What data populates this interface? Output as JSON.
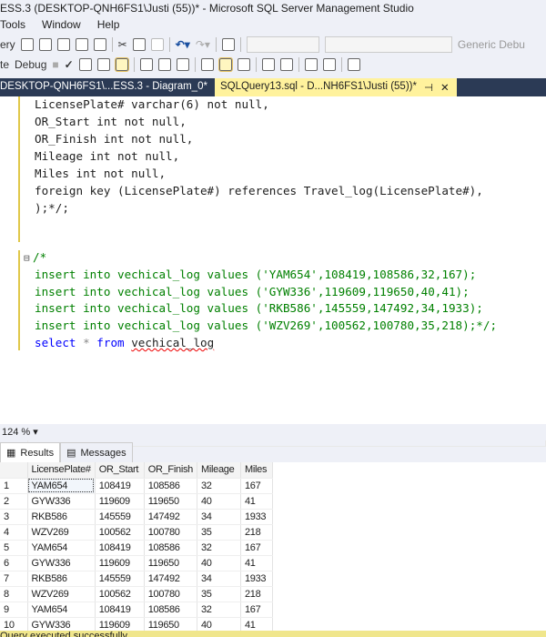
{
  "title": "ESS.3 (DESKTOP-QNH6FS1\\Justi (55))* - Microsoft SQL Server Management Studio",
  "menu": [
    "Tools",
    "Window",
    "Help"
  ],
  "toolbar1": {
    "query_label": "ery",
    "generic_debug": "Generic Debu"
  },
  "toolbar2": {
    "execute_label": "te",
    "debug_label": "Debug"
  },
  "tabs": [
    {
      "label": "DESKTOP-QNH6FS1\\...ESS.3 - Diagram_0*"
    },
    {
      "label": "SQLQuery13.sql - D...NH6FS1\\Justi (55))*",
      "pin": "⊣",
      "close": "✕"
    }
  ],
  "editor": {
    "lines1": [
      "LicensePlate# varchar(6) not null,",
      "OR_Start int not null,",
      "OR_Finish int not null,",
      "Mileage int not null,",
      "Miles int not null,",
      "foreign key (LicensePlate#) references Travel_log(LicensePlate#),",
      ");*/;"
    ],
    "comment_open": "/*",
    "inserts": [
      {
        "pre": "insert into vechical_log values (",
        "str": "'YAM654'",
        "post": ",108419,108586,32,167);"
      },
      {
        "pre": "insert into vechical_log values (",
        "str": "'GYW336'",
        "post": ",119609,119650,40,41);"
      },
      {
        "pre": "insert into vechical_log values (",
        "str": "'RKB586'",
        "post": ",145559,147492,34,1933);"
      },
      {
        "pre": "insert into vechical_log values (",
        "str": "'WZV269'",
        "post": ",100562,100780,35,218);*/;"
      }
    ],
    "select_kw": "select",
    "star": "*",
    "from_kw": "from",
    "table": "vechical_log"
  },
  "zoom": "124 %",
  "results_tabs": [
    "Results",
    "Messages"
  ],
  "grid": {
    "columns": [
      "LicensePlate#",
      "OR_Start",
      "OR_Finish",
      "Mileage",
      "Miles"
    ],
    "rows": [
      [
        "1",
        "YAM654",
        "108419",
        "108586",
        "32",
        "167"
      ],
      [
        "2",
        "GYW336",
        "119609",
        "119650",
        "40",
        "41"
      ],
      [
        "3",
        "RKB586",
        "145559",
        "147492",
        "34",
        "1933"
      ],
      [
        "4",
        "WZV269",
        "100562",
        "100780",
        "35",
        "218"
      ],
      [
        "5",
        "YAM654",
        "108419",
        "108586",
        "32",
        "167"
      ],
      [
        "6",
        "GYW336",
        "119609",
        "119650",
        "40",
        "41"
      ],
      [
        "7",
        "RKB586",
        "145559",
        "147492",
        "34",
        "1933"
      ],
      [
        "8",
        "WZV269",
        "100562",
        "100780",
        "35",
        "218"
      ],
      [
        "9",
        "YAM654",
        "108419",
        "108586",
        "32",
        "167"
      ],
      [
        "10",
        "GYW336",
        "119609",
        "119650",
        "40",
        "41"
      ]
    ]
  },
  "status": "Query executed successfully."
}
